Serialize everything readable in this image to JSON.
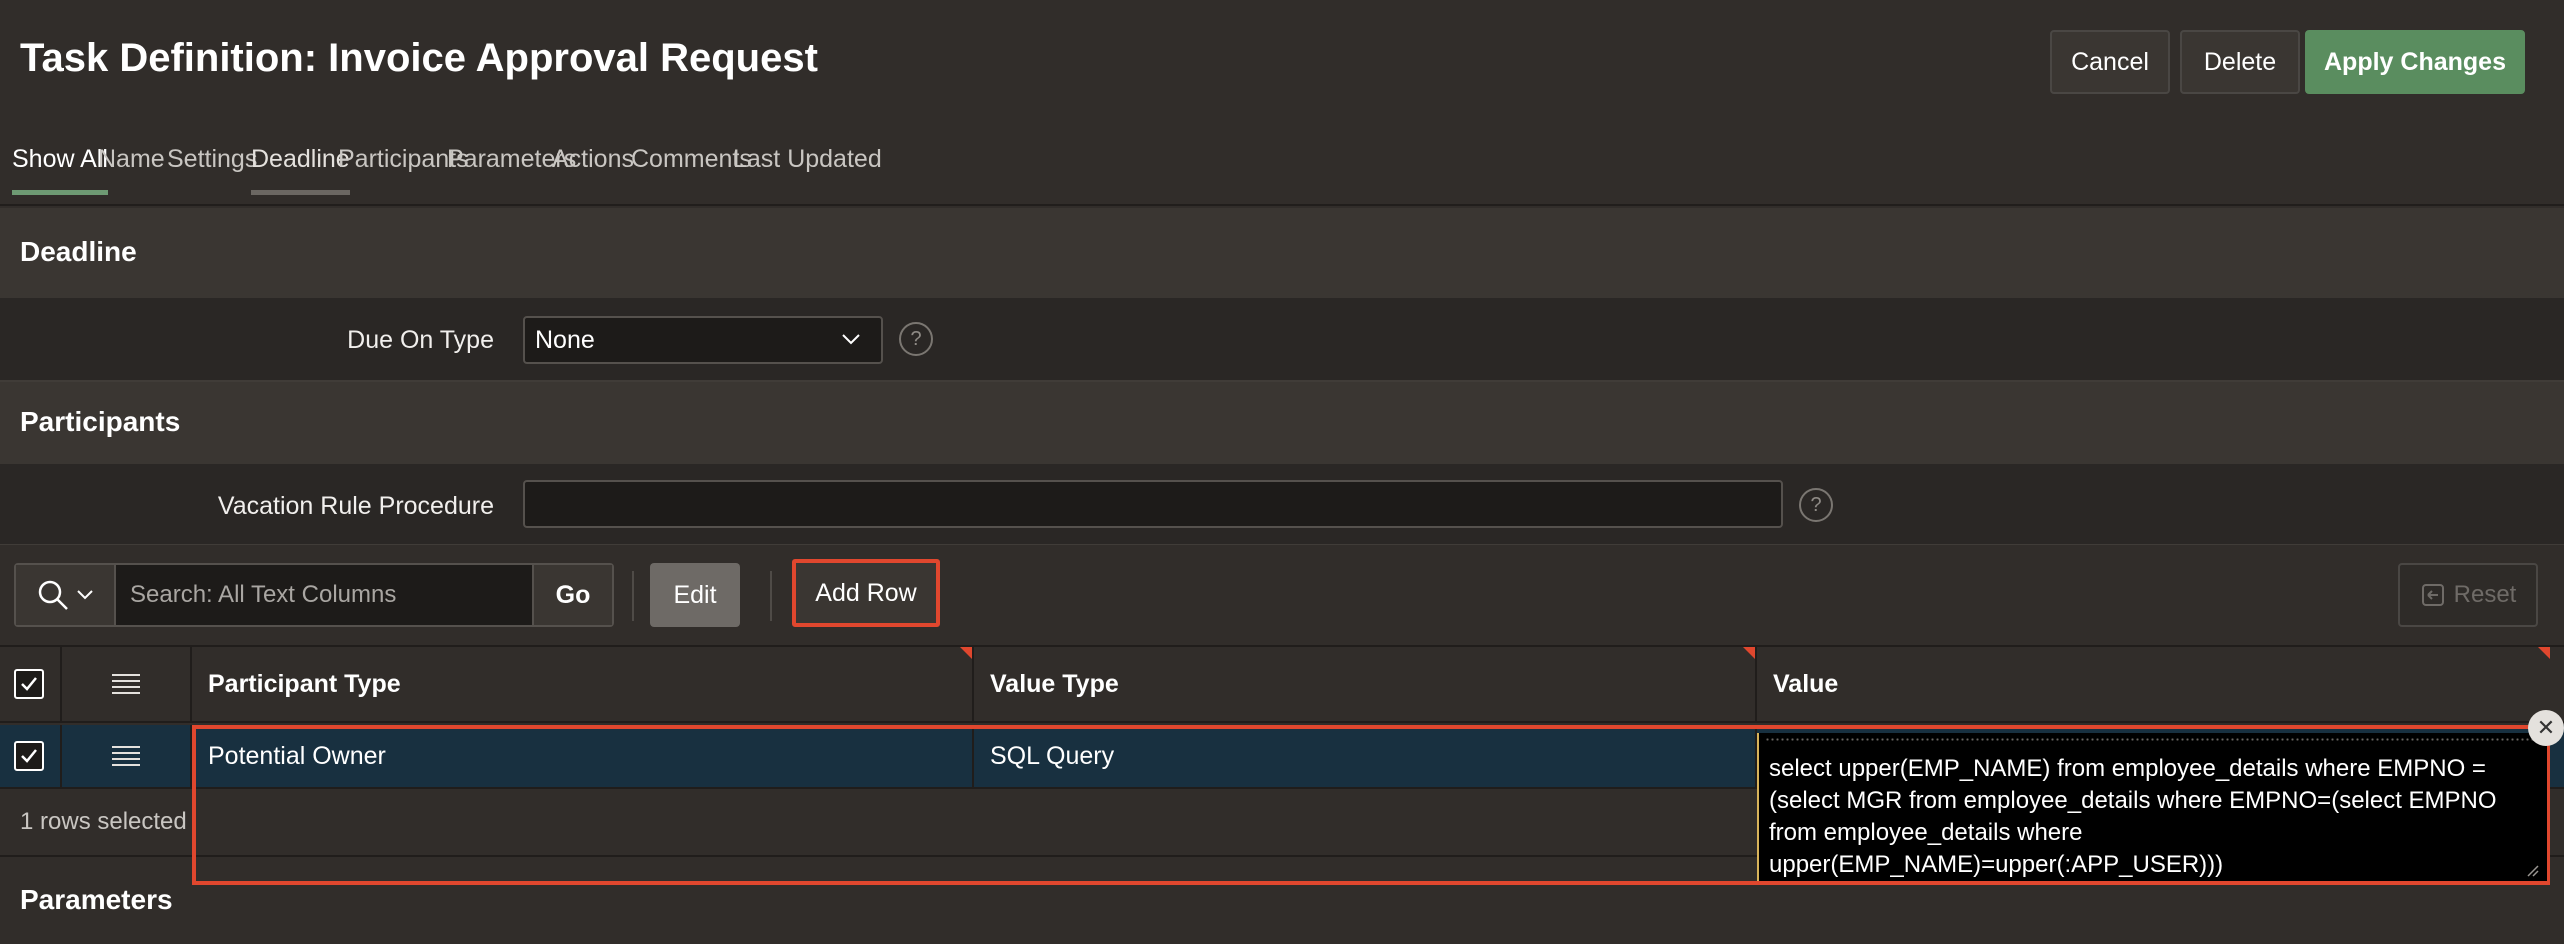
{
  "header": {
    "title": "Task Definition: Invoice Approval Request",
    "cancel_label": "Cancel",
    "delete_label": "Delete",
    "apply_label": "Apply Changes"
  },
  "tabs": [
    {
      "label": "Show All",
      "active": true
    },
    {
      "label": "Name"
    },
    {
      "label": "Settings"
    },
    {
      "label": "Deadline",
      "underlined": true
    },
    {
      "label": "Participants"
    },
    {
      "label": "Parameters"
    },
    {
      "label": "Actions"
    },
    {
      "label": "Comments"
    },
    {
      "label": "Last Updated"
    }
  ],
  "deadline": {
    "section_title": "Deadline",
    "due_on_type_label": "Due On Type",
    "due_on_type_value": "None"
  },
  "participants": {
    "section_title": "Participants",
    "vacation_rule_label": "Vacation Rule Procedure",
    "vacation_rule_value": ""
  },
  "toolbar": {
    "search_placeholder": "Search: All Text Columns",
    "go_label": "Go",
    "edit_label": "Edit",
    "add_row_label": "Add Row",
    "reset_label": "Reset"
  },
  "grid": {
    "columns": [
      "Participant Type",
      "Value Type",
      "Value"
    ],
    "rows": [
      {
        "participant_type": "Potential Owner",
        "value_type": "SQL Query",
        "value": "select upper(EMP_NAME) from employee_details where EMPNO = (select MGR from employee_details where EMPNO=(select EMPNO from employee_details where upper(EMP_NAME)=upper(:APP_USER)))",
        "selected": true
      }
    ],
    "selection_status": "1 rows selected"
  },
  "parameters": {
    "section_title": "Parameters"
  },
  "colors": {
    "accent_green": "#5a8d5f",
    "highlight_red": "#e0472e",
    "selected_row": "#183040"
  }
}
